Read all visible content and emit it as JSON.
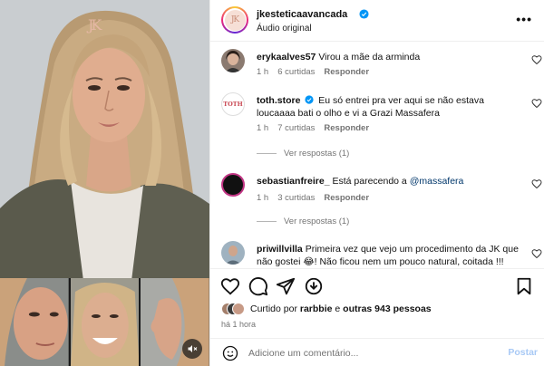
{
  "media": {
    "watermark": "JK"
  },
  "header": {
    "username": "jkesteticaavancada",
    "subtitle": "Áudio original",
    "more": "•••"
  },
  "comments": [
    {
      "user": "erykaalves57",
      "text": "Virou a mãe da arminda",
      "time": "1 h",
      "likes": "6 curtidas",
      "reply": "Responder"
    },
    {
      "user": "toth.store",
      "text": "Eu só entrei pra ver aqui se não estava loucaaaa bati o olho e vi a Grazi Massafera",
      "time": "1 h",
      "likes": "7 curtidas",
      "reply": "Responder",
      "view_replies": "Ver respostas (1)",
      "avatar_text": "TOTH"
    },
    {
      "user": "sebastianfreire_",
      "text_before": "Está parecendo a ",
      "mention": "@massafera",
      "time": "1 h",
      "likes": "3 curtidas",
      "reply": "Responder",
      "view_replies": "Ver respostas (1)"
    },
    {
      "user": "priwillvilla",
      "text": "Primeira vez que vejo um procedimento da JK que não gostei 😂! Não ficou nem um pouco natural, coitada !!!"
    }
  ],
  "likes": {
    "prefix": "Curtido por ",
    "user": "rarbbie",
    "middle": " e ",
    "others": "outras 943 pessoas"
  },
  "time_ago": "há 1 hora",
  "comment_box": {
    "placeholder": "Adicione um comentário...",
    "post": "Postar"
  }
}
